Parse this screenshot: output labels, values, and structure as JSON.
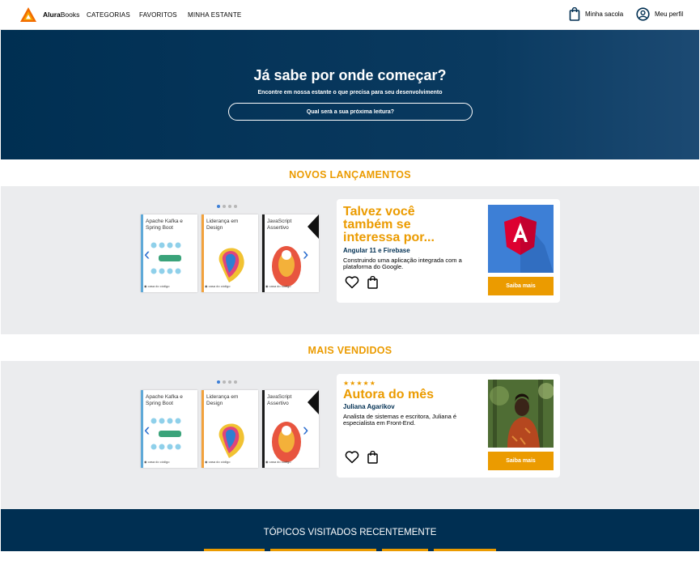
{
  "nav": {
    "brand_bold": "Alura",
    "brand_rest": "Books",
    "links": [
      "CATEGORIAS",
      "FAVORITOS",
      "MINHA ESTANTE"
    ],
    "bag_label": "Minha sacola",
    "profile_label": "Meu perfil"
  },
  "hero": {
    "title": "Já sabe por onde começar?",
    "subtitle": "Encontre em nossa estante o que precisa para seu desenvolvimento",
    "search_placeholder": "Qual será a sua próxima leitura?"
  },
  "releases": {
    "title": "NOVOS LANÇAMENTOS",
    "books": [
      {
        "title": "Apache Kafka e Spring Boot",
        "color": "#5fa9d8"
      },
      {
        "title": "Liderança em Design",
        "color": "#f2a23c"
      },
      {
        "title": "JavaScript Assertivo",
        "color": "#1b1b1b"
      }
    ],
    "card": {
      "heading": "Talvez você também se interessa por...",
      "book_name": "Angular 11 e Firebase",
      "description": "Construindo uma aplicação integrada com a plataforma do Google.",
      "button": "Saiba mais"
    }
  },
  "bestsellers": {
    "title": "MAIS VENDIDOS",
    "books": [
      {
        "title": "Apache Kafka e Spring Boot",
        "color": "#5fa9d8"
      },
      {
        "title": "Liderança em Design",
        "color": "#f2a23c"
      },
      {
        "title": "JavaScript Assertivo",
        "color": "#1b1b1b"
      }
    ],
    "card": {
      "stars": "★★★★★",
      "heading": "Autora do mês",
      "author_name": "Juliana Agarikov",
      "description": "Analista de sistemas e escritora, Juliana é especialista em Front-End.",
      "button": "Saiba mais"
    }
  },
  "topics": {
    "title": "TÓPICOS VISITADOS RECENTEMENTE"
  },
  "colors": {
    "primary": "#002f52",
    "accent": "#eb9b00",
    "band": "#ebecee"
  }
}
